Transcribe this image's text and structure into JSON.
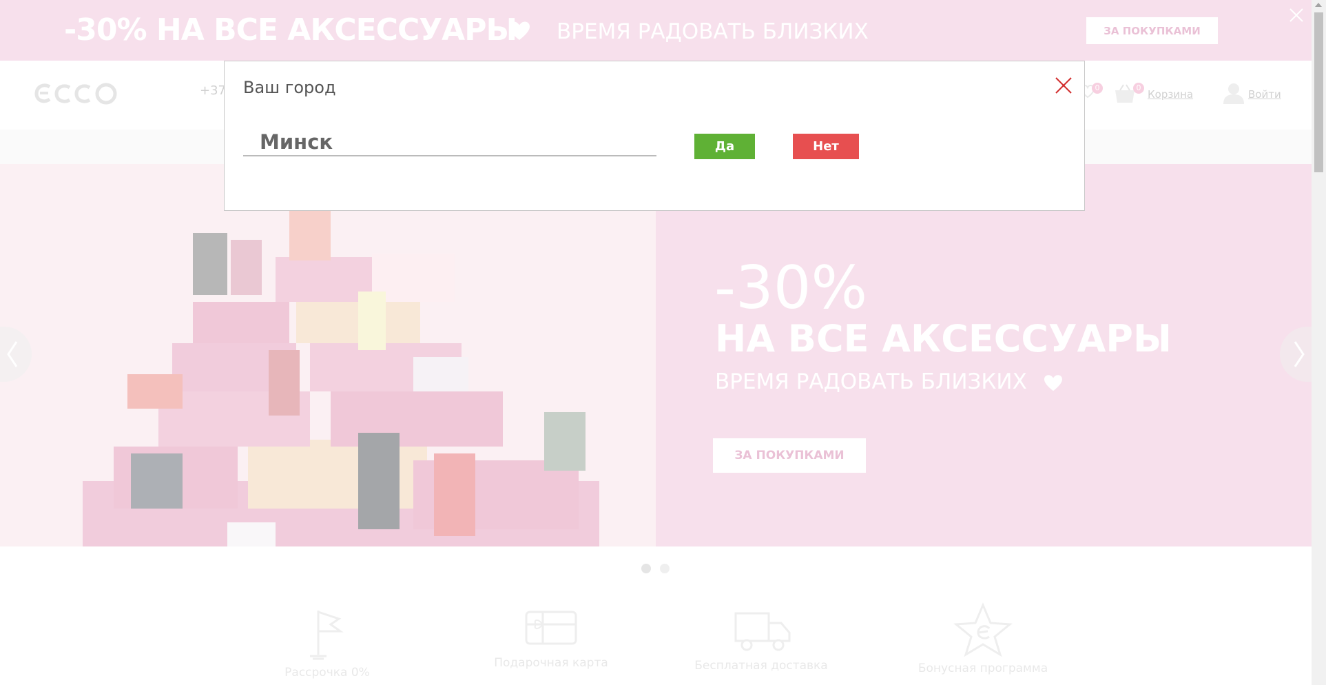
{
  "promo": {
    "headline": "-30% НА ВСЕ АКСЕССУАРЫ",
    "subline": "ВРЕМЯ РАДОВАТЬ БЛИЗКИХ",
    "button_label": "ЗА ПОКУПКАМИ",
    "background_color": "#f1c7dc"
  },
  "header": {
    "logo_text": "ecco",
    "phone_partial": "+37",
    "favorites_count": "0",
    "cart_count": "0",
    "cart_label": "Корзина",
    "login_label": "Войти"
  },
  "hero": {
    "discount": "-30%",
    "title": "НА ВСЕ АКСЕССУАРЫ",
    "subtitle": "ВРЕМЯ РАДОВАТЬ БЛИЗКИХ",
    "button_label": "ЗА ПОКУПКАМИ",
    "slide_count": 2,
    "active_slide": 1
  },
  "features": [
    {
      "label": "Рассрочка 0%",
      "icon": "flag-icon"
    },
    {
      "label": "Подарочная карта",
      "icon": "gift-card-icon"
    },
    {
      "label": "Бесплатная доставка",
      "icon": "truck-icon"
    },
    {
      "label": "Бонусная программа",
      "icon": "star-icon"
    }
  ],
  "city_dialog": {
    "title": "Ваш город",
    "city_value": "Минск",
    "yes_label": "Да",
    "no_label": "Нет",
    "yes_color": "#5fb135",
    "no_color": "#e74f50"
  }
}
